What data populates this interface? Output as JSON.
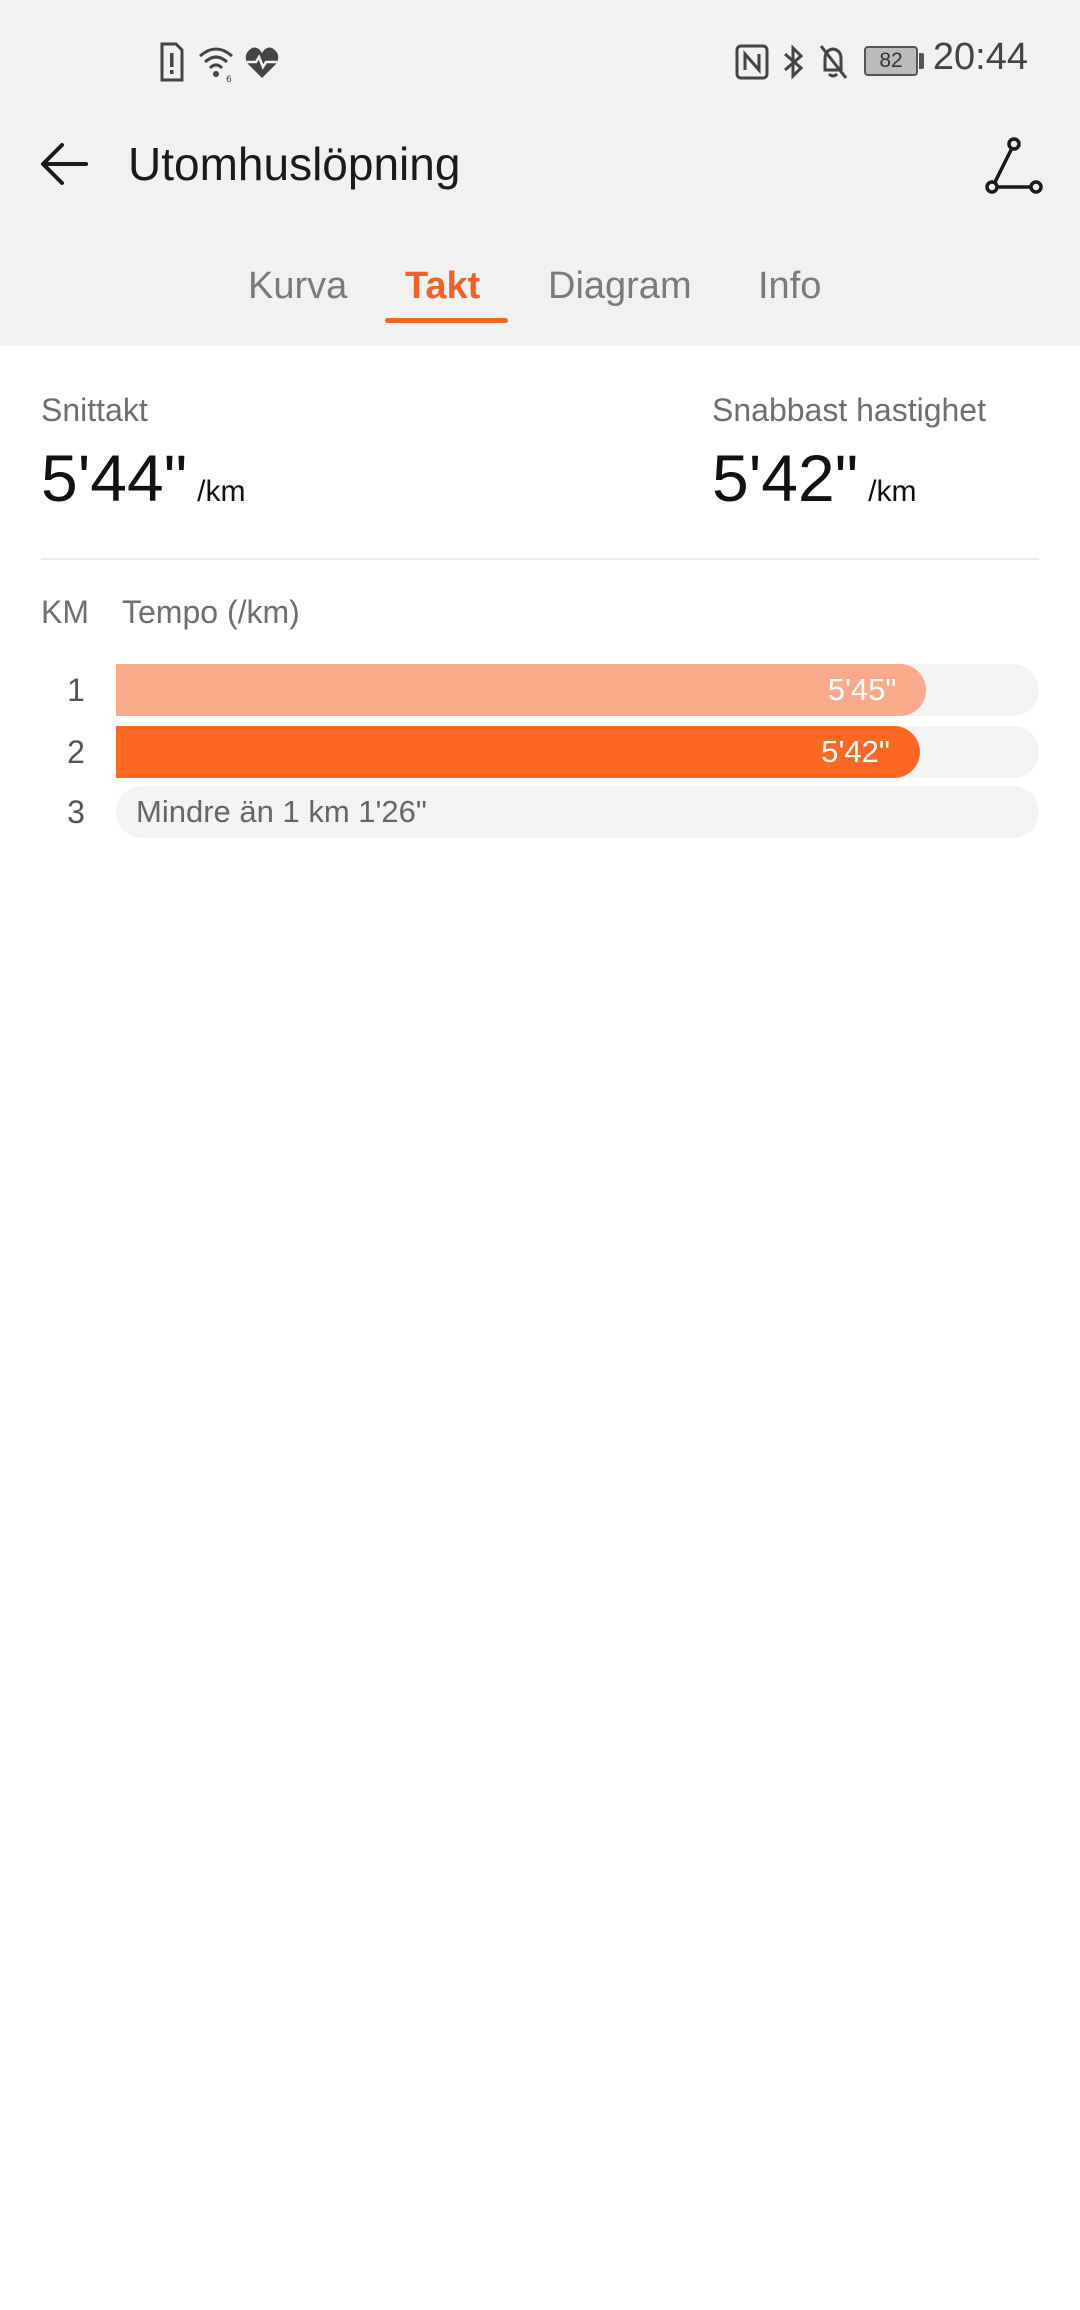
{
  "status_bar": {
    "time": "20:44",
    "battery": "82",
    "left_icons": [
      "sim-alert-icon",
      "wifi-icon",
      "health-heart-icon"
    ],
    "right_icons": [
      "nfc-icon",
      "bluetooth-icon",
      "bell-off-icon",
      "battery-icon"
    ]
  },
  "header": {
    "title": "Utomhuslöpning",
    "back_icon": "arrow-left-icon",
    "route_icon": "route-icon"
  },
  "tabs": [
    {
      "label": "Kurva",
      "active": false
    },
    {
      "label": "Takt",
      "active": true
    },
    {
      "label": "Diagram",
      "active": false
    },
    {
      "label": "Info",
      "active": false
    }
  ],
  "stats": {
    "avg": {
      "label": "Snittakt",
      "value": "5'44\"",
      "unit": "/km"
    },
    "fastest": {
      "label": "Snabbast hastighet",
      "value": "5'42\"",
      "unit": "/km"
    }
  },
  "table": {
    "col_km": "KM",
    "col_tempo": "Tempo (/km)",
    "rows": [
      {
        "km": "1",
        "label": "5'45\"",
        "fraction": 0.878,
        "color": "#f8aa8a"
      },
      {
        "km": "2",
        "label": "5'42\"",
        "fraction": 0.871,
        "color": "#fd6824"
      },
      {
        "km": "3",
        "label": "Mindre än 1 km 1'26\"",
        "fraction": 0,
        "color": "#f3f3f3"
      }
    ]
  },
  "colors": {
    "accent": "#f0622a",
    "header_bg": "#f1f1f1"
  }
}
